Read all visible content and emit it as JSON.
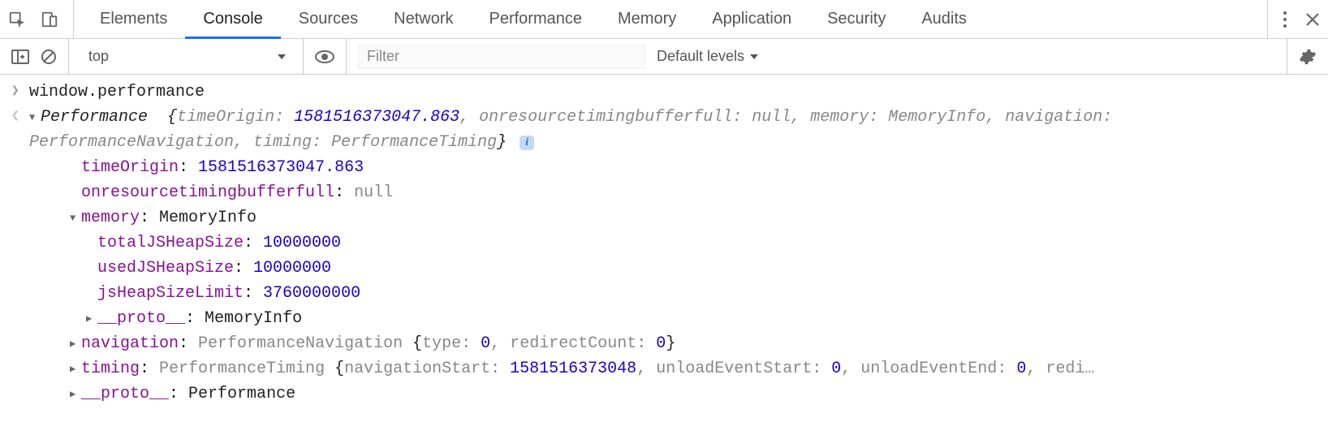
{
  "tabs": {
    "items": [
      "Elements",
      "Console",
      "Sources",
      "Network",
      "Performance",
      "Memory",
      "Application",
      "Security",
      "Audits"
    ],
    "active": "Console"
  },
  "toolbar": {
    "context": "top",
    "filter_placeholder": "Filter",
    "levels_label": "Default levels"
  },
  "console": {
    "input_expr": "window.performance",
    "summary_type": "Performance",
    "summary": {
      "timeOrigin": "1581516373047.863",
      "onresourcetimingbufferfull": "null",
      "memory": "MemoryInfo",
      "navigation": "PerformanceNavigation",
      "timing": "PerformanceTiming"
    },
    "props": {
      "timeOrigin": {
        "key": "timeOrigin",
        "value": "1581516373047.863"
      },
      "onresourcetimingbufferfull": {
        "key": "onresourcetimingbufferfull",
        "value": "null"
      },
      "memory": {
        "key": "memory",
        "type": "MemoryInfo",
        "totalJSHeapSize": {
          "key": "totalJSHeapSize",
          "value": "10000000"
        },
        "usedJSHeapSize": {
          "key": "usedJSHeapSize",
          "value": "10000000"
        },
        "jsHeapSizeLimit": {
          "key": "jsHeapSizeLimit",
          "value": "3760000000"
        },
        "proto": {
          "key": "__proto__",
          "value": "MemoryInfo"
        }
      },
      "navigation": {
        "key": "navigation",
        "type": "PerformanceNavigation",
        "inline": {
          "type_k": "type",
          "type_v": "0",
          "redir_k": "redirectCount",
          "redir_v": "0"
        }
      },
      "timing": {
        "key": "timing",
        "type": "PerformanceTiming",
        "inline": {
          "navStart_k": "navigationStart",
          "navStart_v": "1581516373048",
          "unloadStart_k": "unloadEventStart",
          "unloadStart_v": "0",
          "unloadEnd_k": "unloadEventEnd",
          "unloadEnd_v": "0",
          "trail": "redi…"
        }
      },
      "proto": {
        "key": "__proto__",
        "value": "Performance"
      }
    }
  }
}
